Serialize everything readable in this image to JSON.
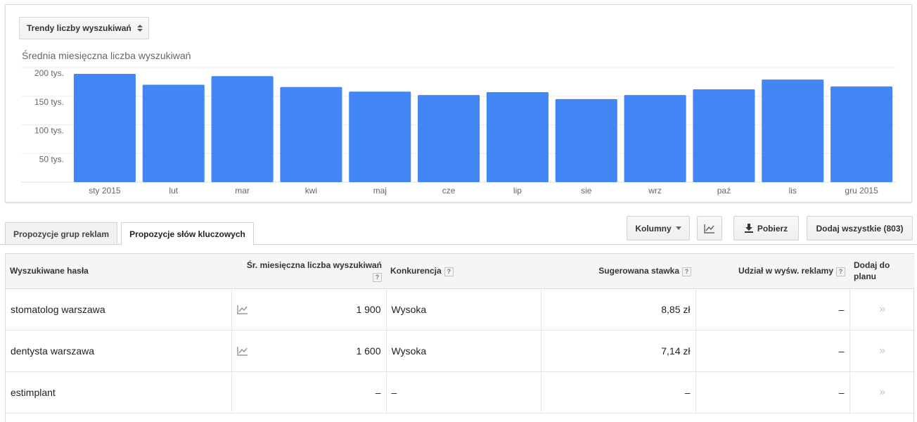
{
  "trend_select": {
    "label": "Trendy liczby wyszukiwań"
  },
  "chart_data": {
    "type": "bar",
    "title": "Średnia miesięczna liczba wyszukiwań",
    "categories": [
      "sty 2015",
      "lut",
      "mar",
      "kwi",
      "maj",
      "cze",
      "lip",
      "sie",
      "wrz",
      "paź",
      "lis",
      "gru 2015"
    ],
    "values": [
      189000,
      170000,
      185000,
      166000,
      158000,
      152000,
      157000,
      145000,
      152000,
      162000,
      179000,
      167000
    ],
    "yticks": [
      {
        "value": 50000,
        "label": "50 tys."
      },
      {
        "value": 100000,
        "label": "100 tys."
      },
      {
        "value": 150000,
        "label": "150 tys."
      },
      {
        "value": 200000,
        "label": "200 tys."
      }
    ],
    "ylim": [
      0,
      200000
    ],
    "grid": true,
    "bar_color": "#4285f4"
  },
  "tabs": {
    "ad_groups": "Propozycje grup reklam",
    "keywords": "Propozycje słów kluczowych"
  },
  "toolbar": {
    "columns": "Kolumny",
    "download": "Pobierz",
    "add_all": "Dodaj wszystkie (803)"
  },
  "table": {
    "headers": {
      "keyword": "Wyszukiwane hasła",
      "avg": "Śr. miesięczna liczba wyszukiwań",
      "competition": "Konkurencja",
      "bid": "Sugerowana stawka",
      "share": "Udział w wyśw. reklamy",
      "add": "Dodaj do planu",
      "help": "?"
    },
    "rows": [
      {
        "keyword": "stomatolog warszawa",
        "avg": "1 900",
        "competition": "Wysoka",
        "bid": "8,85 zł",
        "share": "–",
        "add": "»"
      },
      {
        "keyword": "dentysta warszawa",
        "avg": "1 600",
        "competition": "Wysoka",
        "bid": "7,14 zł",
        "share": "–",
        "add": "»"
      },
      {
        "keyword": "estimplant",
        "avg": "–",
        "competition": "–",
        "bid": "–",
        "share": "–",
        "add": "»"
      }
    ]
  },
  "colors": {
    "accent": "#4285f4",
    "border": "#d9d9d9"
  },
  "icons": {
    "trend": "trend-icon",
    "download": "download-icon",
    "chart": "chart-toggle-icon"
  }
}
